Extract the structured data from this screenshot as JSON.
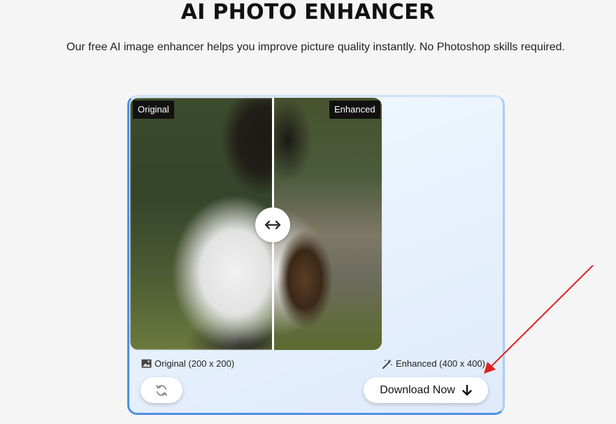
{
  "header": {
    "title": "AI PHOTO ENHANCER",
    "subtitle": "Our free AI image enhancer helps you improve picture quality instantly. No Photoshop skills required."
  },
  "viewer": {
    "original_tag": "Original",
    "enhanced_tag": "Enhanced",
    "slider_position": 0.57
  },
  "info": {
    "original_label": "Original (200 x 200)",
    "enhanced_label": "Enhanced (400 x 400)"
  },
  "actions": {
    "download_label": "Download Now"
  },
  "icons": {
    "image": "image-icon",
    "magic": "magic-wand-icon",
    "refresh": "refresh-icon",
    "swap": "left-right-arrow-icon",
    "download": "down-arrow-icon"
  },
  "colors": {
    "card_border": "#4d8fe6",
    "annotation_arrow": "#e02020"
  }
}
